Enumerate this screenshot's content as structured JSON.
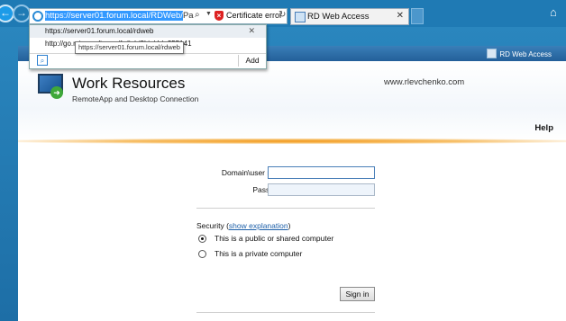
{
  "browser": {
    "address": {
      "selected": "https://server01.forum.local/RDWeb/",
      "rest": "Pages/en-",
      "cert_error": "Certificate error"
    },
    "tab": {
      "title": "RD Web Access"
    },
    "dropdown": {
      "suggestion1": "https://server01.forum.local/rdweb",
      "suggestion2": "http://go.microsoft.com/fwlink/?LinkId=255141",
      "add_label": "Add"
    },
    "tooltip": "https://server01.forum.local/rdweb"
  },
  "page": {
    "brand_bar": "RD Web Access",
    "title": "Work Resources",
    "subtitle": "RemoteApp and Desktop Connection",
    "site": "www.rlevchenko.com",
    "help": "Help",
    "form": {
      "username_label": "Domain\\user name:",
      "username_value": "",
      "password_label": "Password:",
      "password_value": "",
      "security_prefix": "Security (",
      "security_link": "show explanation",
      "security_suffix": ")",
      "option_public": "This is a public or shared computer",
      "option_private": "This is a private computer",
      "signin": "Sign in"
    }
  },
  "colors": {
    "accent": "#1f7ab4",
    "header_bar": "#235f99",
    "glow": "#f39a1e"
  }
}
